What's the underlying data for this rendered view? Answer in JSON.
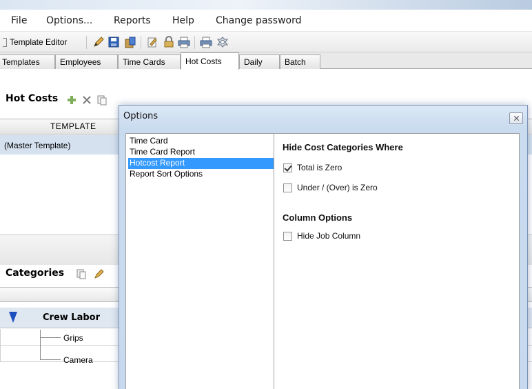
{
  "menu": {
    "items": [
      "File",
      "Options...",
      "Reports",
      "Help",
      "Change password"
    ]
  },
  "toolbar": {
    "template_editor_label": "Template Editor"
  },
  "tabs": [
    "Templates",
    "Employees",
    "Time Cards",
    "Hot Costs",
    "Daily",
    "Batch"
  ],
  "active_tab": "Hot Costs",
  "hot_costs": {
    "title": "Hot Costs",
    "column_header": "TEMPLATE",
    "rows": [
      "(Master Template)"
    ]
  },
  "categories": {
    "title": "Categories",
    "group": "Crew Labor",
    "children": [
      "Grips",
      "Camera"
    ]
  },
  "dialog": {
    "title": "Options",
    "list_items": [
      "Time Card",
      "Time Card Report",
      "Hotcost Report",
      "Report Sort Options"
    ],
    "selected_item": "Hotcost Report",
    "section1_title": "Hide Cost Categories Where",
    "section1_options": [
      {
        "label": "Total is Zero",
        "checked": true
      },
      {
        "label": "Under / (Over) is Zero",
        "checked": false
      }
    ],
    "section2_title": "Column Options",
    "section2_options": [
      {
        "label": "Hide Job Column",
        "checked": false
      }
    ]
  },
  "colors": {
    "selection": "#3399ff",
    "dialog_frame": "#c9dbef",
    "tree_marker": "#1d4fbf"
  }
}
